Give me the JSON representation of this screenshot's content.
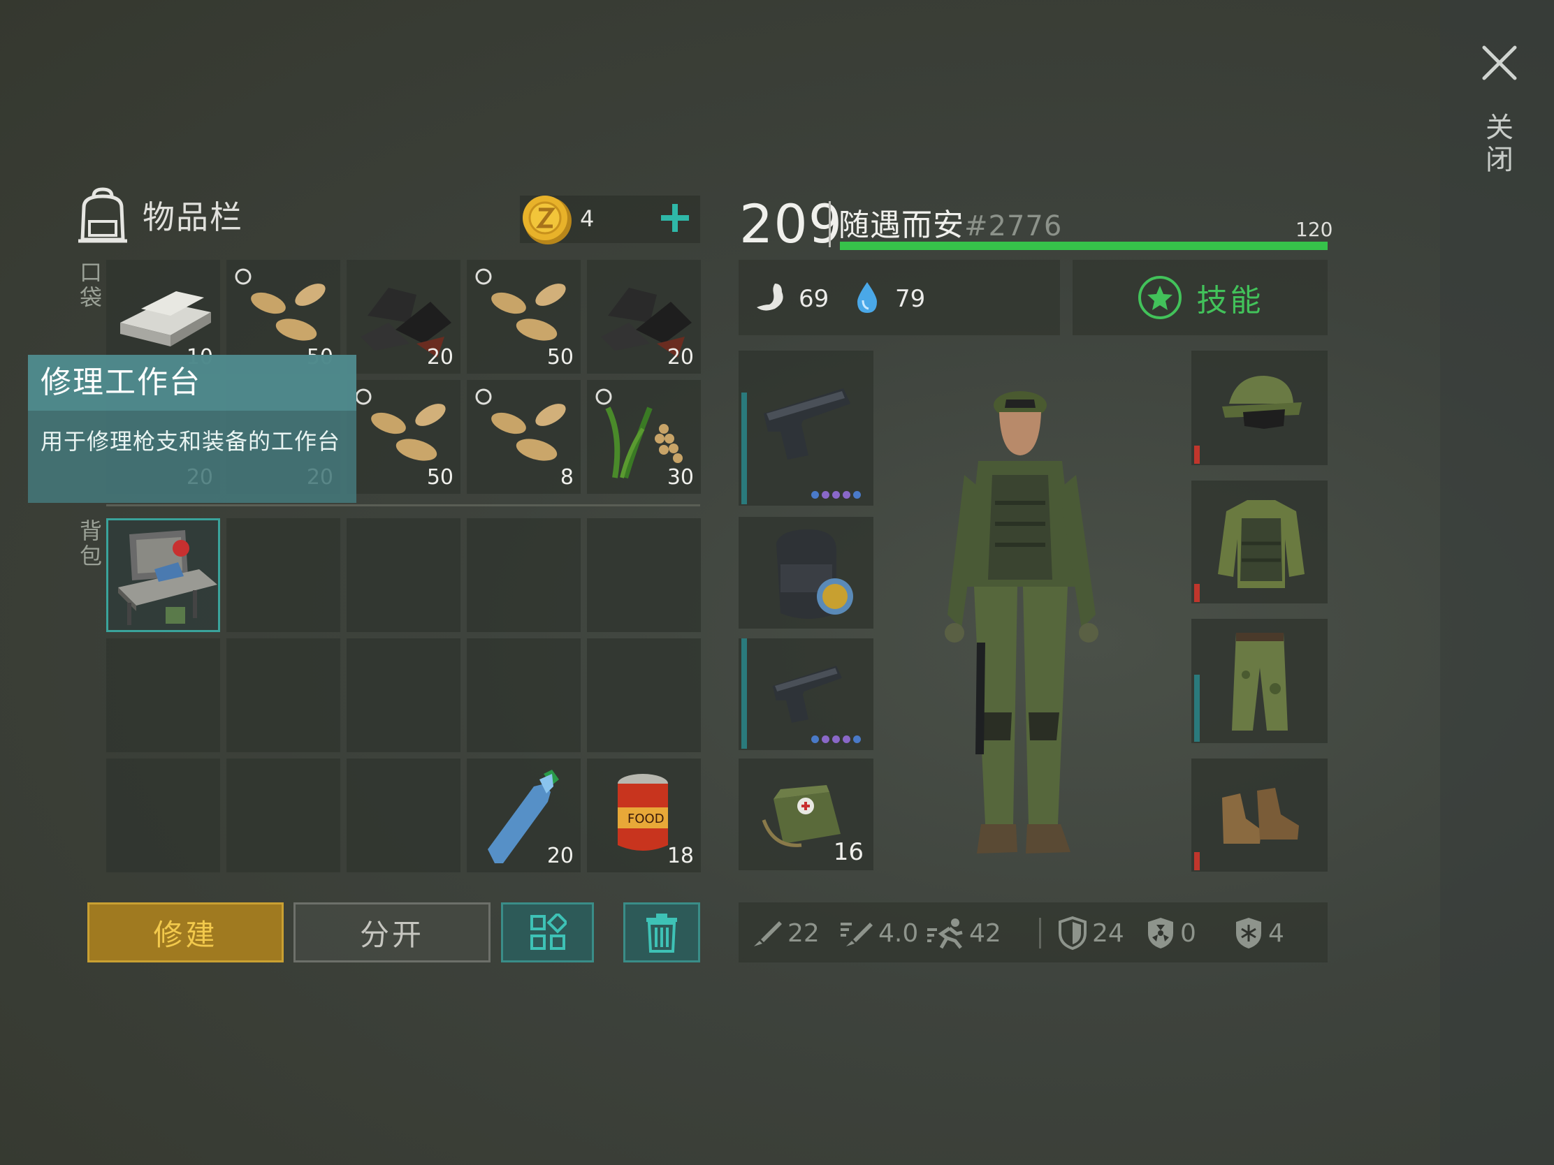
{
  "inventory": {
    "title": "物品栏",
    "coins": "4",
    "section_pocket": "口袋",
    "section_backpack": "背包",
    "pocket_row1": [
      {
        "icon": "iron-bar-icon",
        "qty": "10"
      },
      {
        "icon": "seeds-icon",
        "qty": "50"
      },
      {
        "icon": "coal-icon",
        "qty": "20"
      },
      {
        "icon": "seeds-icon",
        "qty": "50"
      },
      {
        "icon": "coal-icon",
        "qty": "20"
      }
    ],
    "pocket_row2": [
      {
        "icon": "iron-bar-icon",
        "qty": "20"
      },
      {
        "icon": "iron-bar-icon",
        "qty": "20"
      },
      {
        "icon": "seeds-icon",
        "qty": "50"
      },
      {
        "icon": "seeds-icon",
        "qty": "8"
      },
      {
        "icon": "wheat-icon",
        "qty": "30"
      }
    ],
    "backpack_items": {
      "water_bottle_qty": "20",
      "canned_food_qty": "18"
    }
  },
  "tooltip": {
    "title": "修理工作台",
    "description": "用于修理枪支和装备的工作台"
  },
  "buttons": {
    "build": "修建",
    "split": "分开"
  },
  "player": {
    "level": "209",
    "name": "随遇而安",
    "id": "#2776",
    "xp_value": "120",
    "xp_fraction": 1.0,
    "hunger": "69",
    "thirst": "79",
    "skills_label": "技能"
  },
  "equipment": {
    "medkit_qty": "16"
  },
  "armor_stats": {
    "melee_damage": "22",
    "attack_speed": "4.0",
    "movement": "42",
    "defense": "24",
    "radiation": "0",
    "cold": "4"
  },
  "close_label": "关闭",
  "colors": {
    "accent_teal": "#3aa39b",
    "xp_green": "#36c24a",
    "build_gold": "#c9a032",
    "durability_red": "#c0362c"
  }
}
